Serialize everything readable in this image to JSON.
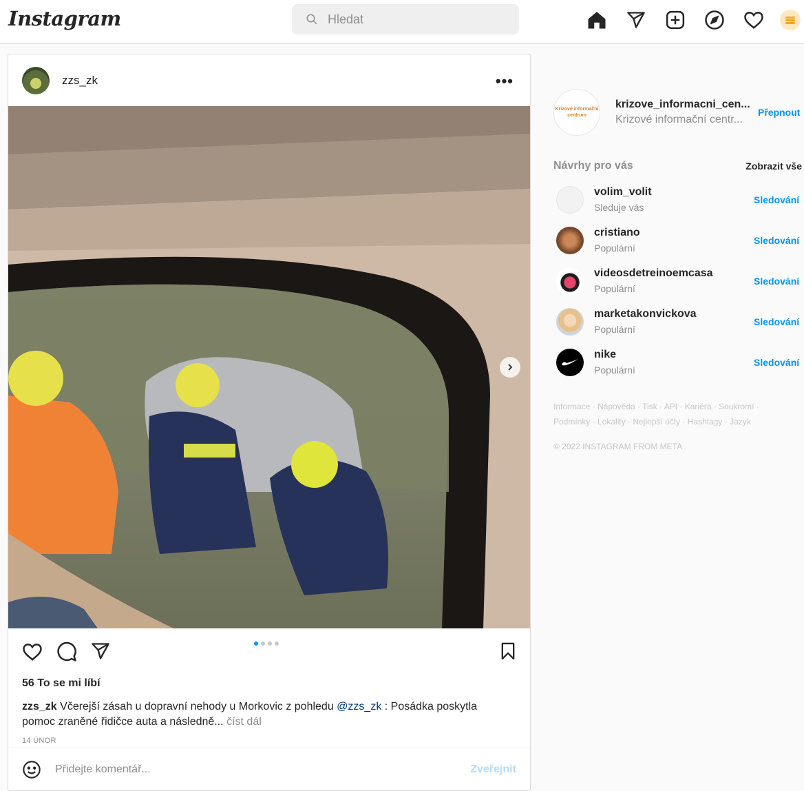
{
  "nav": {
    "logo": "Instagram",
    "search_placeholder": "Hledat",
    "icons": [
      "home-icon",
      "direct-icon",
      "new-post-icon",
      "explore-icon",
      "activity-icon",
      "profile-avatar"
    ]
  },
  "post": {
    "username": "zzs_zk",
    "more": "•••",
    "image_count": 4,
    "active_image": 1,
    "likes": "56 To se mi líbí",
    "caption_user": "zzs_zk",
    "caption_text_1": "Včerejší zásah u dopravní nehody u Morkovic z pohledu",
    "caption_mention": "@zzs_zk",
    "caption_text_2": ": Posádka poskytla pomoc zraněné řidičce auta a následně...",
    "caption_more": "číst dál",
    "date": "14 ÚNOR",
    "comment_placeholder": "Přidejte komentář...",
    "publish": "Zveřejnit"
  },
  "sidebar": {
    "account_username": "krizove_informacni_cen...",
    "account_name": "Krizové informační centr...",
    "account_avatar_text": "Krizové informační centrum",
    "switch": "Přepnout",
    "suggestions_title": "Návrhy pro vás",
    "see_all": "Zobrazit vše",
    "suggestions": [
      {
        "username": "volim_volit",
        "note": "Sleduje vás",
        "action": "Sledování"
      },
      {
        "username": "cristiano",
        "note": "Populární",
        "action": "Sledování"
      },
      {
        "username": "videosdetreinoemcasa",
        "note": "Populární",
        "action": "Sledování"
      },
      {
        "username": "marketakonvickova",
        "note": "Populární",
        "action": "Sledování"
      },
      {
        "username": "nike",
        "note": "Populární",
        "action": "Sledování"
      }
    ],
    "footer_line1": "Informace · Nápověda · Tisk · API · Kariéra · Soukromí ·",
    "footer_line2": "Podmínky · Lokality · Nejlepší účty · Hashtagy · Jazyk",
    "copyright": "© 2022 INSTAGRAM FROM META"
  },
  "colors": {
    "accent": "#0095f6",
    "publish_disabled": "#b3dbff",
    "muted": "#8e8e8e"
  }
}
